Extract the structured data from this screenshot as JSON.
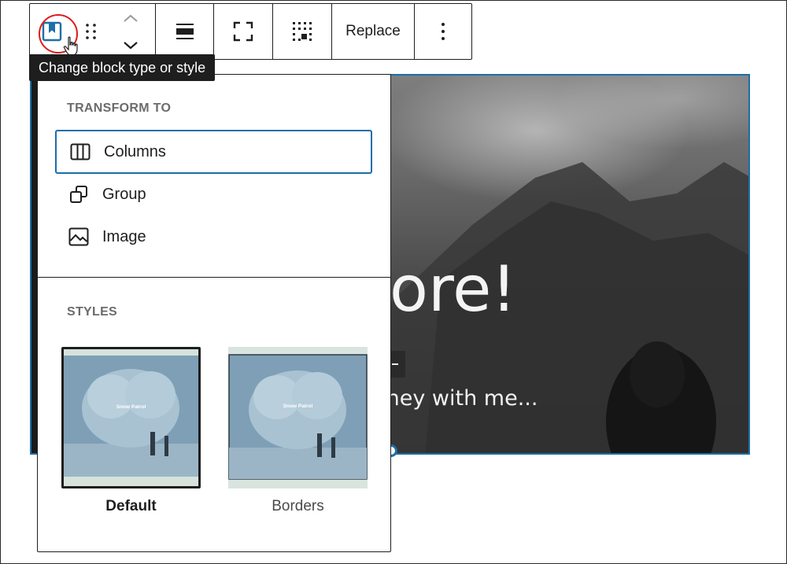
{
  "toolbar": {
    "replace_label": "Replace"
  },
  "tooltip": {
    "text": "Change block type or style"
  },
  "popover": {
    "transform_title": "TRANSFORM TO",
    "transform_items": [
      {
        "label": "Columns",
        "icon": "columns-icon"
      },
      {
        "label": "Group",
        "icon": "group-icon"
      },
      {
        "label": "Image",
        "icon": "image-icon"
      }
    ],
    "styles_title": "STYLES",
    "styles": [
      {
        "label": "Default",
        "preview_text": "Snow Patrol",
        "selected": true
      },
      {
        "label": "Borders",
        "preview_text": "Snow Patrol",
        "selected": false
      }
    ]
  },
  "cover": {
    "heading_visible": "ore!",
    "subtext_visible": "rney with me..."
  },
  "colors": {
    "accent": "#1c6fa8",
    "highlight": "#e01b1b",
    "tooltip_bg": "#1e1e1e"
  }
}
